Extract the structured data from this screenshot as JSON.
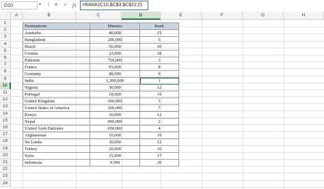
{
  "name_box": "D10",
  "formula": "=RANK(C10,$C$3:$C$22,0)",
  "columns": [
    "A",
    "B",
    "C",
    "D",
    "E",
    "F",
    "G",
    "H"
  ],
  "rows": [
    "1",
    "2",
    "3",
    "4",
    "5",
    "6",
    "7",
    "8",
    "9",
    "10",
    "11",
    "12",
    "13",
    "14",
    "15",
    "16",
    "17",
    "18",
    "19",
    "20",
    "21",
    "22",
    "23",
    "24"
  ],
  "table": {
    "headers": [
      "Destinations",
      "Minutes",
      "Rank"
    ],
    "rows": [
      [
        "Australia",
        "40,000",
        "15"
      ],
      [
        "Bangladesh",
        "200,000",
        "5"
      ],
      [
        "Brazil",
        "56,000",
        "10"
      ],
      [
        "Croatia",
        "22,000",
        "18"
      ],
      [
        "Pakistan",
        "750,000",
        "3"
      ],
      [
        "France",
        "95,000",
        "8"
      ],
      [
        "Germany",
        "88,000",
        "9"
      ],
      [
        "India",
        "1,200,000",
        "1"
      ],
      [
        "Nigeria",
        "30,000",
        "12"
      ],
      [
        "Portugal",
        "18,000",
        "19"
      ],
      [
        "United Kingdom",
        "200,000",
        "5"
      ],
      [
        "United States of America",
        "100,000",
        "7"
      ],
      [
        "Kenya",
        "30,000",
        "12"
      ],
      [
        "Nepal",
        "900,000",
        "2"
      ],
      [
        "United Arab Emirates",
        "650,000",
        "4"
      ],
      [
        "Afghanistan",
        "10,000",
        "19"
      ],
      [
        "Sri Lanka",
        "30,000",
        "12"
      ],
      [
        "Turkey",
        "20,000",
        "16"
      ],
      [
        "Syria",
        "15,000",
        "17"
      ],
      [
        "Indonesia",
        "9,500",
        "20"
      ]
    ]
  }
}
